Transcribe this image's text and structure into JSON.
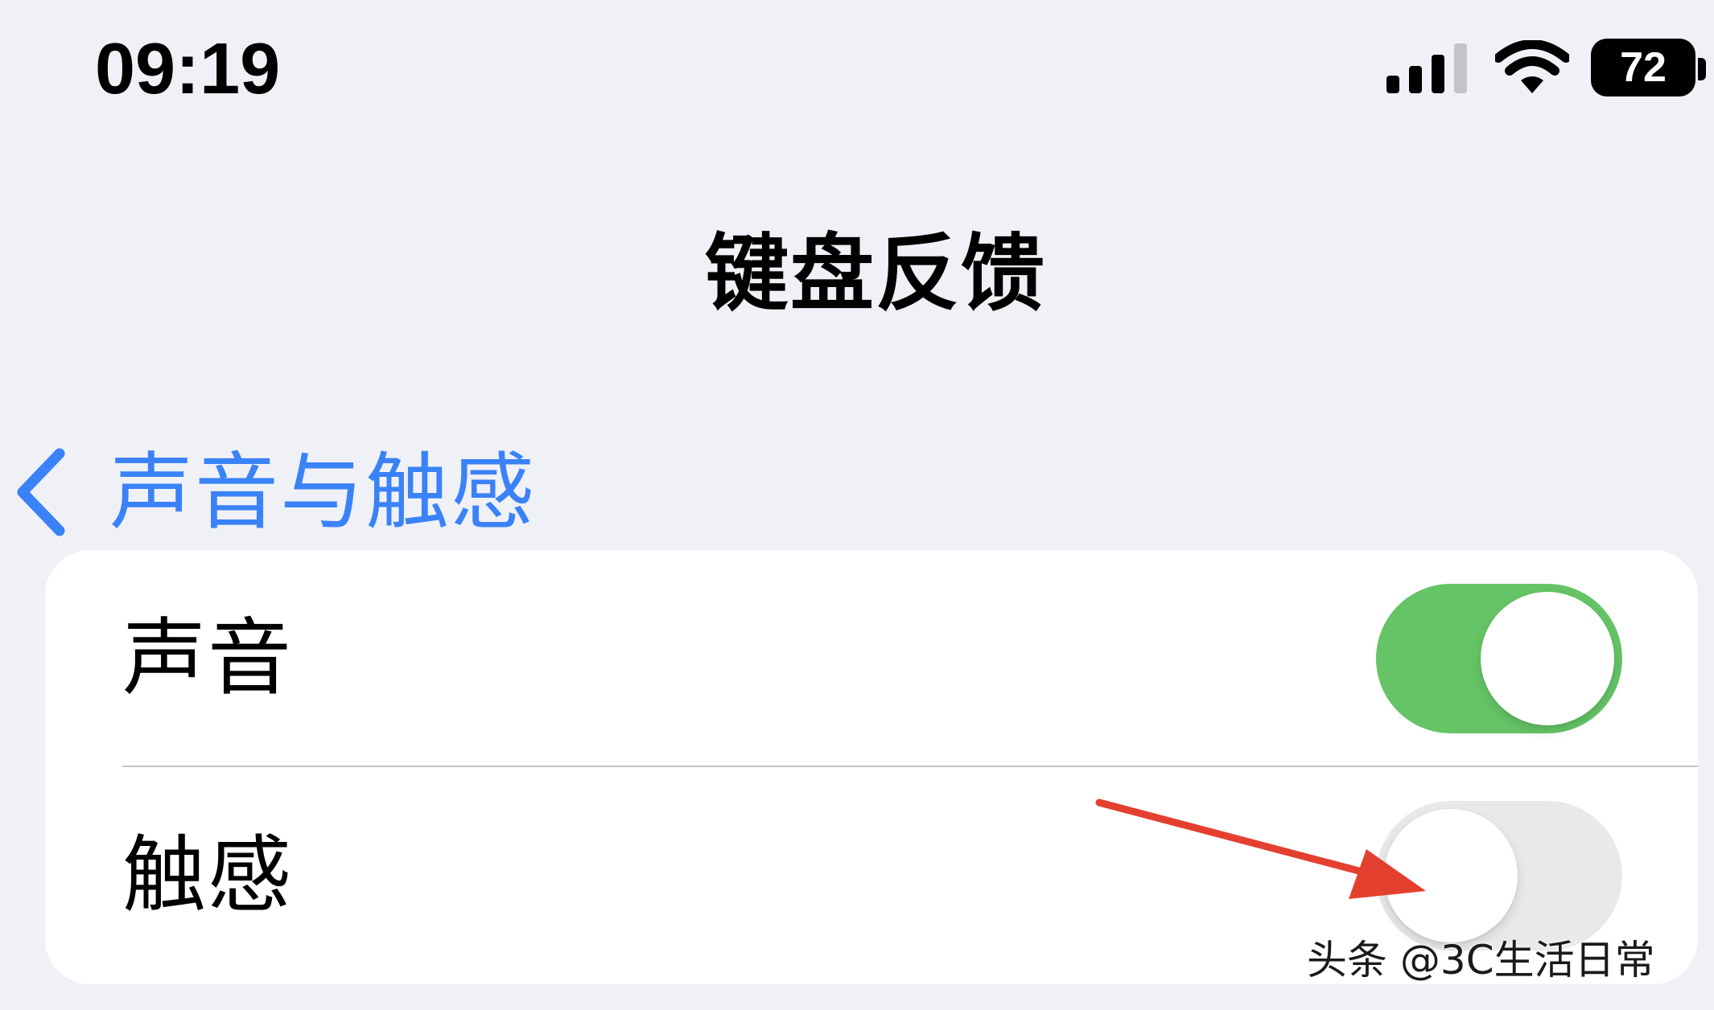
{
  "status_bar": {
    "time": "09:19",
    "battery_level": "72",
    "icons": [
      "cellular-signal-icon",
      "wifi-icon",
      "battery-icon"
    ]
  },
  "nav_bar": {
    "back_label": "声音与触感",
    "title": "键盘反馈",
    "back_icon": "chevron-left-icon"
  },
  "settings": {
    "rows": [
      {
        "label": "声音",
        "enabled": true
      },
      {
        "label": "触感",
        "enabled": false
      }
    ]
  },
  "colors": {
    "background": "#f0f1f6",
    "accent_blue": "#3a82f7",
    "toggle_on": "#65c466",
    "toggle_off": "#e9e9eb",
    "annotation_arrow": "#e4402f"
  },
  "watermark": "头条 @3C生活日常"
}
